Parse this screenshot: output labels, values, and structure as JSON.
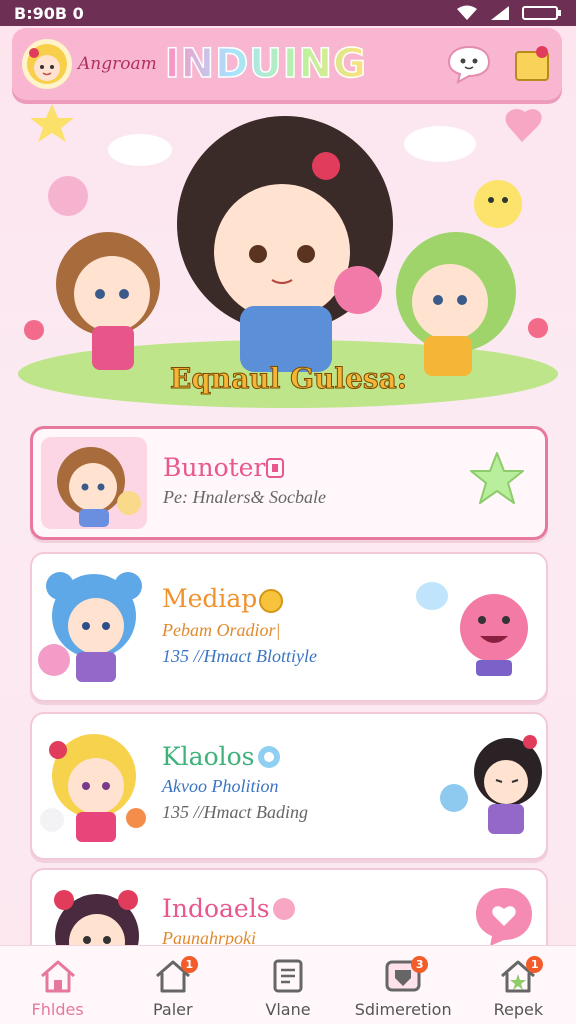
{
  "status": {
    "time": "B:90B 0"
  },
  "header": {
    "brand_sub": "Angroam",
    "brand_title": "INDUING"
  },
  "hero": {
    "title": "Eqnaul Gulesa:"
  },
  "cards": [
    {
      "title": "Bunoter",
      "line1": "Pe: Hnalers& Socbale",
      "line2": ""
    },
    {
      "title": "Mediap",
      "line1": "Pebam Oradior|",
      "line2": "135 //Hmact Blottiyle"
    },
    {
      "title": "Klaolos",
      "line1": "Akvoo Pholition",
      "line2": "135 //Hmact Bading"
    },
    {
      "title": "Indoaels",
      "line1": "Paunahrpoki",
      "line2": ""
    }
  ],
  "nav": [
    {
      "label": "Fhldes",
      "badge": ""
    },
    {
      "label": "Paler",
      "badge": "1"
    },
    {
      "label": "Vlane",
      "badge": ""
    },
    {
      "label": "Sdimeretion",
      "badge": "3"
    },
    {
      "label": "Repek",
      "badge": "1"
    }
  ],
  "colors": {
    "accent": "#e6789e",
    "status_bar": "#6e2f55",
    "topbar": "#f9b6d0"
  }
}
